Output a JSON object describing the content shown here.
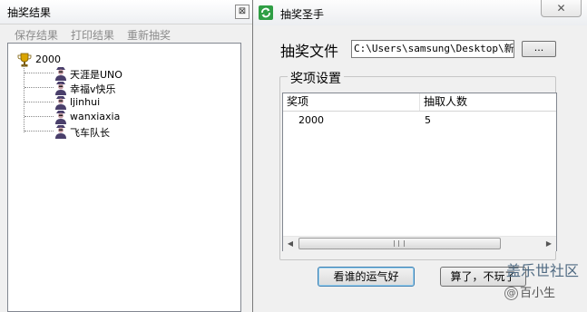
{
  "left_window": {
    "title": "抽奖结果",
    "close_glyph": "⊠",
    "menu": [
      "保存结果",
      "打印结果",
      "重新抽奖"
    ],
    "tree": {
      "root": "2000",
      "children": [
        "天涯是UNO",
        "幸福v快乐",
        "ljinhui",
        "wanxiaxia",
        "飞车队长"
      ]
    }
  },
  "dialog": {
    "title": "抽奖圣手",
    "close_glyph": "✕",
    "file_label": "抽奖文件",
    "file_value": "C:\\Users\\samsung\\Desktop\\新建",
    "browse_label": "...",
    "group_title": "奖项设置",
    "columns": [
      "奖项",
      "抽取人数"
    ],
    "rows": [
      [
        "2000",
        "5"
      ]
    ],
    "scroll_left": "◀",
    "scroll_right": "▶",
    "lucky_button": "看谁的运气好",
    "quit_button": "算了，不玩了"
  },
  "watermark": {
    "forum": "盖乐世社区",
    "user_prefix": "@",
    "user": "百小生"
  },
  "colors": {
    "app_icon": "#2f9e44",
    "trophy": "#d9a400",
    "person": "#4a3f6b"
  }
}
